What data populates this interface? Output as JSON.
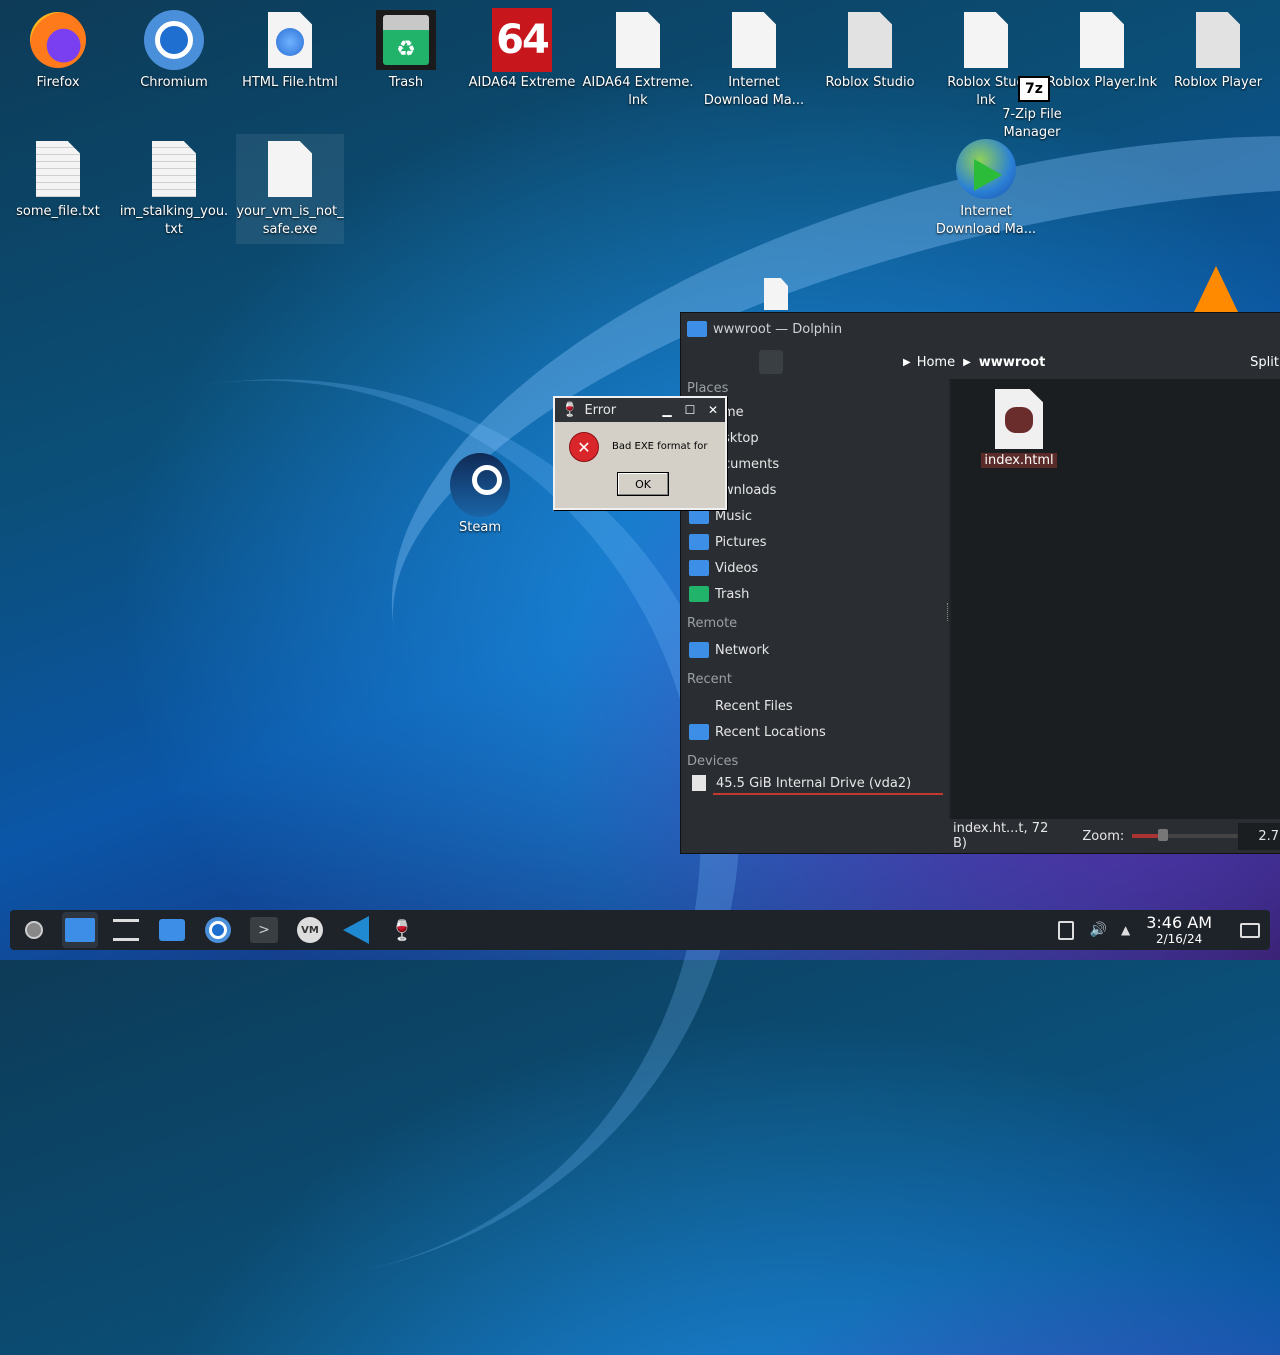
{
  "desktop": {
    "icons": [
      {
        "label": "Firefox"
      },
      {
        "label": "Chromium"
      },
      {
        "label": "HTML File.html"
      },
      {
        "label": "Trash"
      },
      {
        "label": "AIDA64 Extreme",
        "badge": "64"
      },
      {
        "label": "AIDA64 Extreme.\nlnk"
      },
      {
        "label": "Internet\nDownload Ma..."
      },
      {
        "label": "Roblox Studio"
      },
      {
        "label": "Roblox Stud\nlnk"
      },
      {
        "label": "Roblox Player.lnk"
      },
      {
        "label": "Roblox Player"
      },
      {
        "label": "some_file.txt"
      },
      {
        "label": "im_stalking_you.\ntxt"
      },
      {
        "label": "your_vm_is_not_\nsafe.exe"
      },
      {
        "label": "7-Zip File\nManager",
        "badge": "7z"
      },
      {
        "label": "Internet\nDownload Ma..."
      },
      {
        "label": "Steam"
      }
    ]
  },
  "dolphin": {
    "title": "wwwroot — Dolphin",
    "breadcrumb": {
      "home": "Home",
      "current": "wwwroot"
    },
    "split_label": "Split",
    "places_header": "Places",
    "places": [
      {
        "label": "ome"
      },
      {
        "label": "esktop"
      },
      {
        "label": "ocuments"
      },
      {
        "label": "ownloads"
      },
      {
        "label": "Music"
      },
      {
        "label": "Pictures"
      },
      {
        "label": "Videos"
      },
      {
        "label": "Trash"
      }
    ],
    "remote_header": "Remote",
    "remote": [
      {
        "label": "Network"
      }
    ],
    "recent_header": "Recent",
    "recent": [
      {
        "label": "Recent Files"
      },
      {
        "label": "Recent Locations"
      }
    ],
    "devices_header": "Devices",
    "devices": [
      {
        "label": "45.5 GiB Internal Drive (vda2)"
      }
    ],
    "file": {
      "label": "index.html"
    },
    "status_text": "index.ht...t, 72 B)",
    "zoom_label": "Zoom:",
    "free_label": "2.7"
  },
  "error_dialog": {
    "title": "Error",
    "message": "Bad EXE format for",
    "ok_label": "OK"
  },
  "taskbar": {
    "time": "3:46 AM",
    "date": "2/16/24"
  },
  "colors": {
    "accent": "#3d8ee6",
    "error_red": "#d9262b"
  }
}
